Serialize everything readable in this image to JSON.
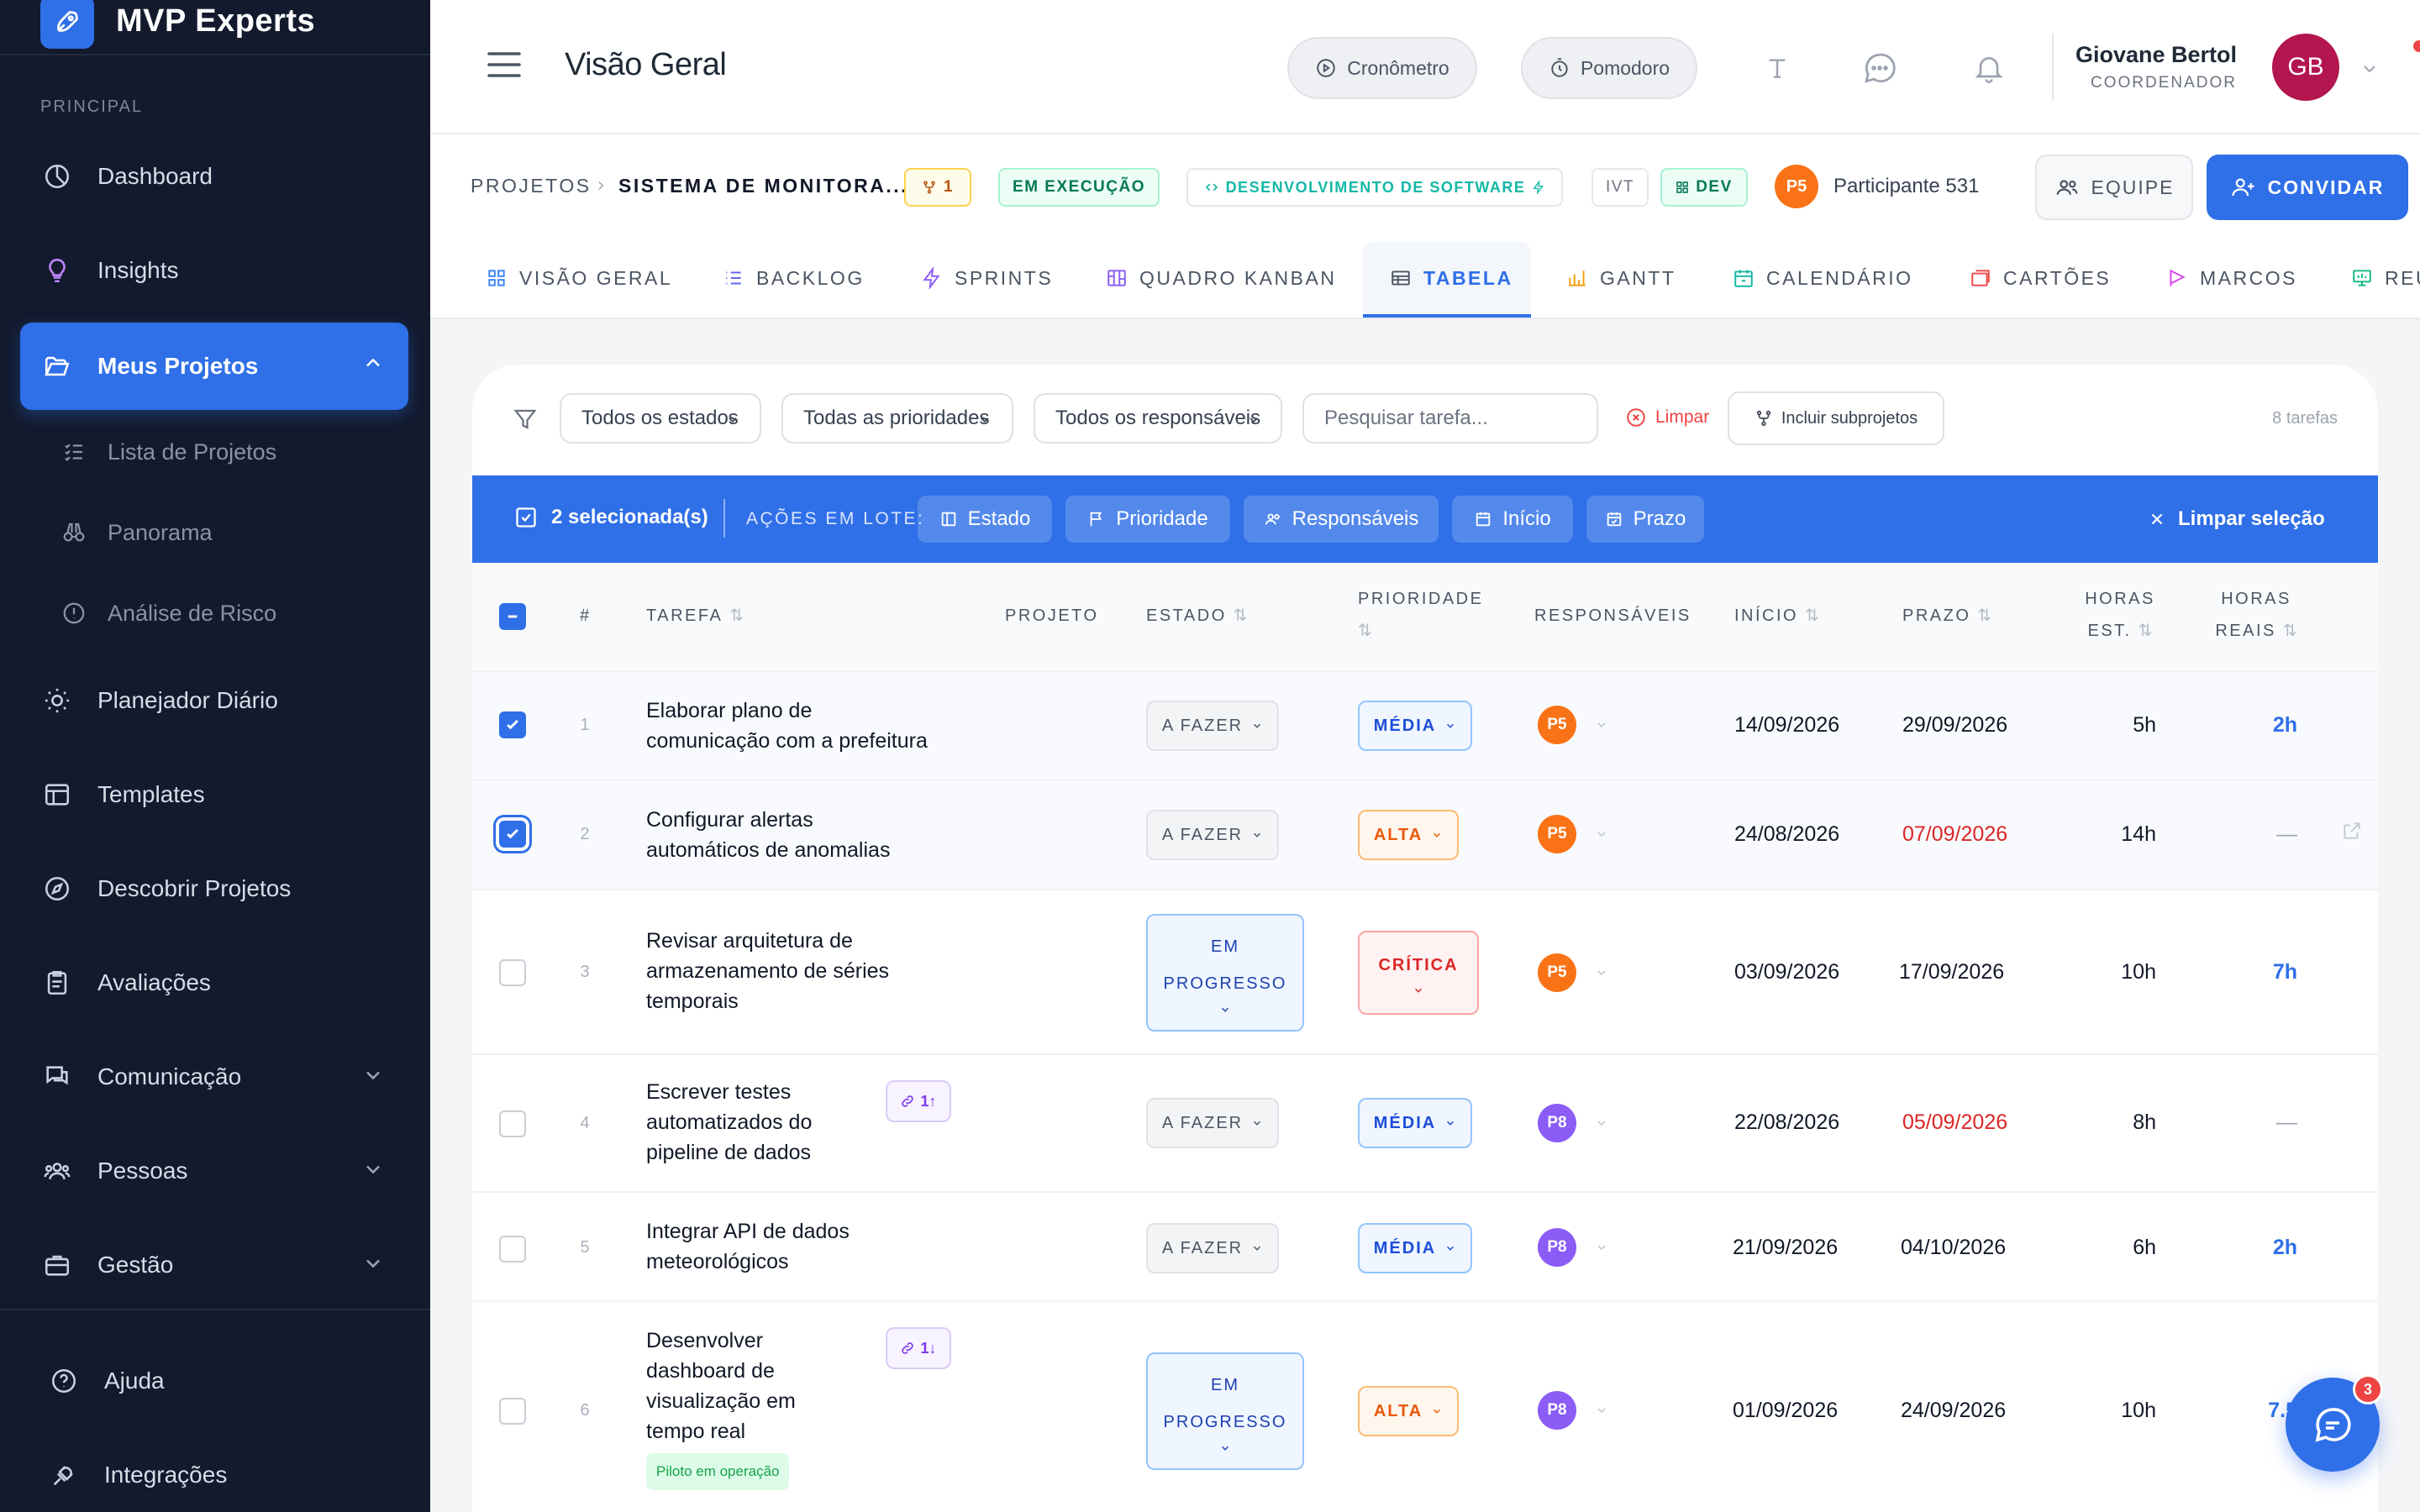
{
  "brand": {
    "name": "MVP Experts"
  },
  "sidebar": {
    "section_label": "PRINCIPAL",
    "items": [
      {
        "label": "Dashboard"
      },
      {
        "label": "Insights"
      },
      {
        "label": "Meus Projetos"
      },
      {
        "label": "Planejador Diário"
      },
      {
        "label": "Templates"
      },
      {
        "label": "Descobrir Projetos"
      },
      {
        "label": "Avaliações"
      },
      {
        "label": "Comunicação"
      },
      {
        "label": "Pessoas"
      },
      {
        "label": "Gestão"
      }
    ],
    "sub_items": [
      {
        "label": "Lista de Projetos"
      },
      {
        "label": "Panorama"
      },
      {
        "label": "Análise de Risco"
      }
    ],
    "bottom": [
      {
        "label": "Ajuda"
      },
      {
        "label": "Integrações"
      }
    ]
  },
  "header": {
    "title": "Visão Geral",
    "cronometro": "Cronômetro",
    "pomodoro": "Pomodoro",
    "user_name": "Giovane Bertol",
    "user_role": "COORDENADOR",
    "avatar_initials": "GB"
  },
  "project": {
    "crumb_root": "PROJETOS",
    "crumb_name": "SISTEMA DE MONITORA...",
    "fork_count": "1",
    "status": "EM EXECUÇÃO",
    "category": "DESENVOLVIMENTO DE SOFTWARE",
    "code": "IVT",
    "env": "DEV",
    "participant_initials": "P5",
    "participant_name": "Participante 531",
    "equipe_label": "EQUIPE",
    "convidar_label": "CONVIDAR"
  },
  "tabs": [
    {
      "label": "VISÃO GERAL"
    },
    {
      "label": "BACKLOG"
    },
    {
      "label": "SPRINTS"
    },
    {
      "label": "QUADRO KANBAN"
    },
    {
      "label": "TABELA"
    },
    {
      "label": "GANTT"
    },
    {
      "label": "CALENDÁRIO"
    },
    {
      "label": "CARTÕES"
    },
    {
      "label": "MARCOS"
    },
    {
      "label": "REU"
    }
  ],
  "filters": {
    "estado": "Todos os estados",
    "prioridade": "Todas as prioridades",
    "responsaveis": "Todos os responsáveis",
    "search_placeholder": "Pesquisar tarefa...",
    "limpar": "Limpar",
    "subprojetos": "Incluir subprojetos",
    "count": "8 tarefas"
  },
  "bulk": {
    "selected": "2  selecionada(s)",
    "label": "AÇÕES EM LOTE:",
    "estado": "Estado",
    "prioridade": "Prioridade",
    "responsaveis": "Responsáveis",
    "inicio": "Início",
    "prazo": "Prazo",
    "clear": "Limpar seleção"
  },
  "table": {
    "headers": {
      "num": "#",
      "tarefa": "TAREFA",
      "projeto": "PROJETO",
      "estado": "ESTADO",
      "prioridade": "PRIORIDADE",
      "responsaveis": "RESPONSÁVEIS",
      "inicio": "INÍCIO",
      "prazo": "PRAZO",
      "horas_est_1": "HORAS",
      "horas_est_2": "EST.",
      "horas_reais_1": "HORAS",
      "horas_reais_2": "REAIS"
    },
    "rows": [
      {
        "num": "1",
        "title": "Elaborar plano de comunicação com a prefeitura",
        "status": "A FAZER",
        "priority": "MÉDIA",
        "assignee": "P5",
        "start": "14/09/2026",
        "due": "29/09/2026",
        "est": "5h",
        "real": "2h"
      },
      {
        "num": "2",
        "title": "Configurar alertas automáticos de anomalias",
        "status": "A FAZER",
        "priority": "ALTA",
        "assignee": "P5",
        "start": "24/08/2026",
        "due": "07/09/2026",
        "est": "14h",
        "real": "—"
      },
      {
        "num": "3",
        "title": "Revisar arquitetura de armazenamento de séries temporais",
        "status_1": "EM",
        "status_2": "PROGRESSO",
        "priority": "CRÍTICA",
        "assignee": "P5",
        "start": "03/09/2026",
        "due": "17/09/2026",
        "est": "10h",
        "real": "7h"
      },
      {
        "num": "4",
        "title": "Escrever testes automatizados do pipeline de dados",
        "dep": "1↑",
        "status": "A FAZER",
        "priority": "MÉDIA",
        "assignee": "P8",
        "start": "22/08/2026",
        "due": "05/09/2026",
        "est": "8h",
        "real": "—"
      },
      {
        "num": "5",
        "title": "Integrar API de dados meteorológicos",
        "status": "A FAZER",
        "priority": "MÉDIA",
        "assignee": "P8",
        "start": "21/09/2026",
        "due": "04/10/2026",
        "est": "6h",
        "real": "2h"
      },
      {
        "num": "6",
        "title": "Desenvolver dashboard de visualização em tempo real",
        "dep": "1↓",
        "tag": "Piloto em operação",
        "status_1": "EM",
        "status_2": "PROGRESSO",
        "priority": "ALTA",
        "assignee": "P8",
        "start": "01/09/2026",
        "due": "24/09/2026",
        "est": "10h",
        "real": "7.5"
      }
    ]
  },
  "chat": {
    "badge": "3"
  },
  "colors": {
    "accent": "#2f6fe8",
    "sidebar_bg": "#131a2e",
    "late": "#dc2626",
    "p5": "#f97316",
    "p8": "#8b5cf6"
  }
}
